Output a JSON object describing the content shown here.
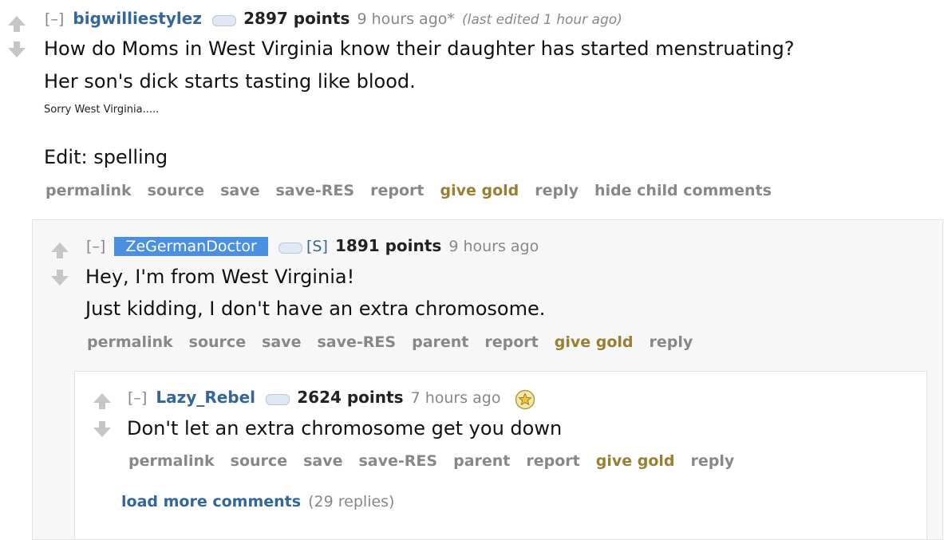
{
  "comments": [
    {
      "toggle": "[–]",
      "author": "bigwilliestylez",
      "score": "2897 points",
      "time": "9 hours ago*",
      "edited": "(last edited 1 hour ago)",
      "lines": [
        "How do Moms in West Virginia know their daughter has started menstruating?",
        "Her son's dick starts tasting like blood."
      ],
      "small": "Sorry  West  Virginia.....",
      "edit": "Edit: spelling",
      "buttons": [
        "permalink",
        "source",
        "save",
        "save-RES",
        "report",
        "give gold",
        "reply",
        "hide child comments"
      ]
    },
    {
      "toggle": "[–]",
      "author": "ZeGermanDoctor",
      "submitter": "[S]",
      "score": "1891 points",
      "time": "9 hours ago",
      "lines": [
        "Hey, I'm from West Virginia!",
        "Just kidding, I don't have an extra chromosome."
      ],
      "buttons": [
        "permalink",
        "source",
        "save",
        "save-RES",
        "parent",
        "report",
        "give gold",
        "reply"
      ]
    },
    {
      "toggle": "[–]",
      "author": "Lazy_Rebel",
      "score": "2624 points",
      "time": "7 hours ago",
      "lines": [
        "Don't let an extra chromosome get you down"
      ],
      "buttons": [
        "permalink",
        "source",
        "save",
        "save-RES",
        "parent",
        "report",
        "give gold",
        "reply"
      ]
    }
  ],
  "load_more": {
    "label": "load more comments",
    "count": "(29 replies)"
  },
  "colors": {
    "author": "#336699",
    "gold": "#9a7f32",
    "op_box": "#4a90e2",
    "muted": "#888888"
  }
}
